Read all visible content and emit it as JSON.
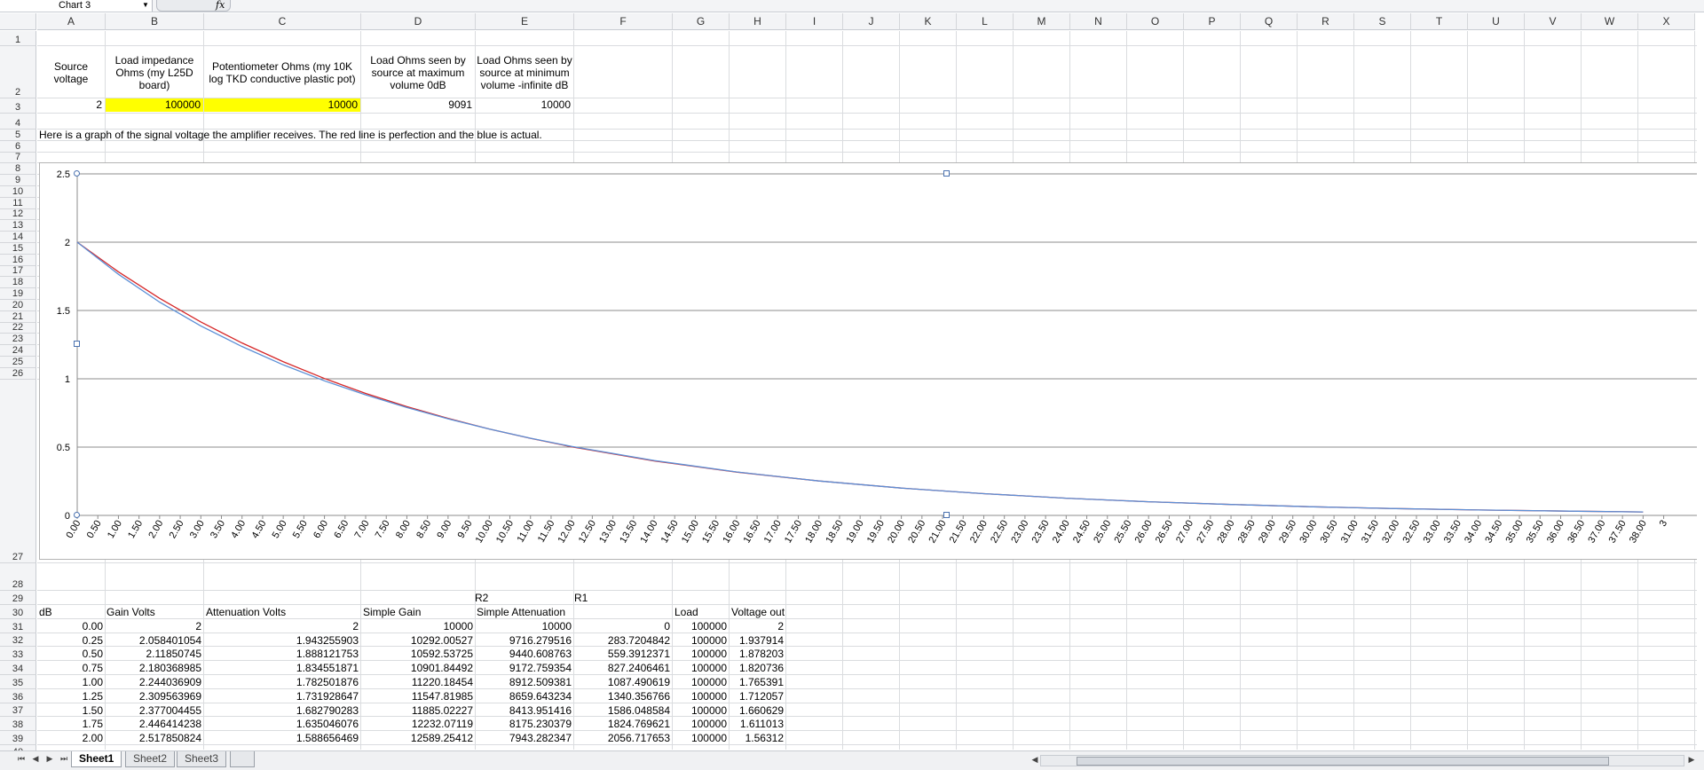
{
  "name_box": {
    "value": "Chart 3"
  },
  "formula_bar": {
    "fx_label": "fx",
    "value": ""
  },
  "columns": [
    "A",
    "B",
    "C",
    "D",
    "E",
    "F",
    "G",
    "H",
    "I",
    "J",
    "K",
    "L",
    "M",
    "N",
    "O",
    "P",
    "Q",
    "R",
    "S",
    "T",
    "U",
    "V",
    "W",
    "X"
  ],
  "rows": [
    "1",
    "2",
    "3",
    "4",
    "5",
    "6",
    "7",
    "8",
    "9",
    "10",
    "11",
    "12",
    "13",
    "14",
    "15",
    "16",
    "17",
    "18",
    "19",
    "20",
    "21",
    "22",
    "23",
    "24",
    "25",
    "26",
    "27",
    "28",
    "29",
    "30",
    "31",
    "32",
    "33",
    "34",
    "35",
    "36",
    "37",
    "38",
    "39",
    "40"
  ],
  "header_row": {
    "a": "Source voltage",
    "b": "Load impedance Ohms (my L25D board)",
    "c": "Potentiometer Ohms (my 10K log TKD conductive plastic pot)",
    "d": "Load Ohms seen by source at maximum volume 0dB",
    "e": "Load Ohms seen by source at minimum volume -infinite dB"
  },
  "value_row": {
    "a": "2",
    "b": "100000",
    "c": "10000",
    "d": "9091",
    "e": "10000"
  },
  "note": "Here is a graph of the signal voltage the amplifier receives.  The red line is perfection and the blue is actual.",
  "chart_data": {
    "type": "line",
    "title": "",
    "xlabel": "",
    "ylabel": "",
    "ylim": [
      0,
      2.5
    ],
    "yticks": [
      "0",
      "0.5",
      "1",
      "1.5",
      "2",
      "2.5"
    ],
    "x_step": 0.25,
    "x_label_step": 0.5,
    "x_labels_visible": [
      "0.00",
      "0.50",
      "1.00",
      "1.50",
      "2.00",
      "2.50",
      "3.00",
      "3.50",
      "4.00",
      "4.50",
      "5.00",
      "5.50",
      "6.00",
      "6.50",
      "7.00",
      "7.50",
      "8.00",
      "8.50",
      "9.00",
      "9.50",
      "10.00",
      "10.50",
      "11.00",
      "11.50",
      "12.00",
      "12.50",
      "13.00",
      "13.50",
      "14.00",
      "14.50",
      "15.00",
      "15.50",
      "16.00",
      "16.50",
      "17.00",
      "17.50",
      "18.00",
      "18.50",
      "19.00",
      "19.50",
      "20.00",
      "20.50",
      "21.00",
      "21.50",
      "22.00",
      "22.50",
      "23.00",
      "23.50",
      "24.00",
      "24.50",
      "25.00",
      "25.50",
      "26.00",
      "26.50",
      "27.00",
      "27.50",
      "28.00",
      "28.50",
      "29.00",
      "29.50",
      "30.00",
      "30.50",
      "31.00",
      "31.50",
      "32.00",
      "32.50",
      "33.00",
      "33.50",
      "34.00",
      "34.50",
      "35.00",
      "35.50",
      "36.00",
      "36.50",
      "37.00",
      "37.50",
      "38.00",
      "3"
    ],
    "series": [
      {
        "color": "#d62728",
        "x": [
          0,
          1,
          2,
          3,
          4,
          5,
          6,
          7,
          8,
          9,
          10,
          11,
          12,
          14,
          16,
          18,
          20,
          22,
          24,
          26,
          28,
          30,
          32,
          34,
          36,
          38
        ],
        "values": [
          2.0,
          1.783,
          1.589,
          1.416,
          1.262,
          1.125,
          1.002,
          0.893,
          0.796,
          0.71,
          0.632,
          0.564,
          0.502,
          0.399,
          0.317,
          0.252,
          0.2,
          0.159,
          0.126,
          0.1,
          0.08,
          0.063,
          0.05,
          0.04,
          0.032,
          0.025
        ]
      },
      {
        "color": "#5b8fd6",
        "x": [
          0,
          1,
          2,
          3,
          4,
          5,
          6,
          7,
          8,
          9,
          10,
          11,
          12,
          14,
          16,
          18,
          20,
          22,
          24,
          26,
          28,
          30,
          32,
          34,
          36,
          38
        ],
        "values": [
          2.0,
          1.765,
          1.561,
          1.387,
          1.236,
          1.102,
          0.985,
          0.882,
          0.79,
          0.707,
          0.632,
          0.565,
          0.505,
          0.402,
          0.318,
          0.252,
          0.2,
          0.159,
          0.126,
          0.1,
          0.08,
          0.063,
          0.05,
          0.04,
          0.032,
          0.025
        ]
      }
    ]
  },
  "table": {
    "row29": {
      "e": "R2",
      "f": "R1"
    },
    "headers": {
      "a": "dB",
      "b": "Gain Volts",
      "c": "Attenuation Volts",
      "d": "Simple Gain",
      "e": "Simple Attenuation",
      "g": "Load",
      "h": "Voltage out"
    },
    "rows": [
      {
        "a": "0.00",
        "b": "2",
        "c": "2",
        "d": "10000",
        "e": "10000",
        "f": "0",
        "g": "100000",
        "h": "2"
      },
      {
        "a": "0.25",
        "b": "2.058401054",
        "c": "1.943255903",
        "d": "10292.00527",
        "e": "9716.279516",
        "f": "283.7204842",
        "g": "100000",
        "h": "1.937914"
      },
      {
        "a": "0.50",
        "b": "2.11850745",
        "c": "1.888121753",
        "d": "10592.53725",
        "e": "9440.608763",
        "f": "559.3912371",
        "g": "100000",
        "h": "1.878203"
      },
      {
        "a": "0.75",
        "b": "2.180368985",
        "c": "1.834551871",
        "d": "10901.84492",
        "e": "9172.759354",
        "f": "827.2406461",
        "g": "100000",
        "h": "1.820736"
      },
      {
        "a": "1.00",
        "b": "2.244036909",
        "c": "1.782501876",
        "d": "11220.18454",
        "e": "8912.509381",
        "f": "1087.490619",
        "g": "100000",
        "h": "1.765391"
      },
      {
        "a": "1.25",
        "b": "2.309563969",
        "c": "1.731928647",
        "d": "11547.81985",
        "e": "8659.643234",
        "f": "1340.356766",
        "g": "100000",
        "h": "1.712057"
      },
      {
        "a": "1.50",
        "b": "2.377004455",
        "c": "1.682790283",
        "d": "11885.02227",
        "e": "8413.951416",
        "f": "1586.048584",
        "g": "100000",
        "h": "1.660629"
      },
      {
        "a": "1.75",
        "b": "2.446414238",
        "c": "1.635046076",
        "d": "12232.07119",
        "e": "8175.230379",
        "f": "1824.769621",
        "g": "100000",
        "h": "1.611013"
      },
      {
        "a": "2.00",
        "b": "2.517850824",
        "c": "1.588656469",
        "d": "12589.25412",
        "e": "7943.282347",
        "f": "2056.717653",
        "g": "100000",
        "h": "1.56312"
      }
    ]
  },
  "sheets": [
    "Sheet1",
    "Sheet2",
    "Sheet3"
  ],
  "active_sheet": "Sheet1"
}
